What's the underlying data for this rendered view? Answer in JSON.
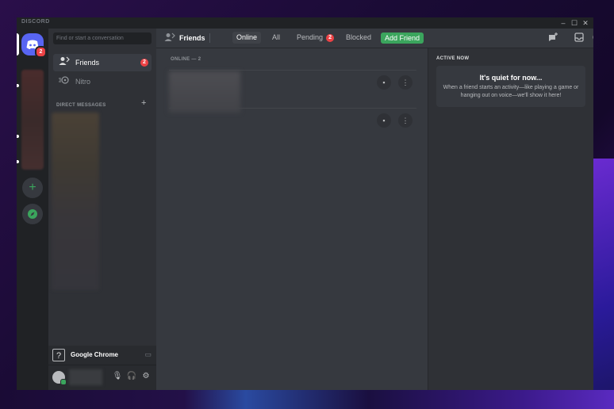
{
  "window": {
    "app_name": "DISCORD",
    "controls": [
      "–",
      "☐",
      "✕"
    ]
  },
  "rail": {
    "home_badge": "2"
  },
  "sidebar": {
    "search_placeholder": "Find or start a conversation",
    "items": [
      {
        "label": "Friends",
        "badge": "2",
        "icon": "friends-icon"
      },
      {
        "label": "Nitro",
        "icon": "nitro-icon"
      }
    ],
    "dm_header": "DIRECT MESSAGES",
    "activity_name": "Google Chrome"
  },
  "topbar": {
    "title": "Friends",
    "tabs": [
      {
        "label": "Online",
        "active": true
      },
      {
        "label": "All"
      },
      {
        "label": "Pending",
        "badge": "2"
      },
      {
        "label": "Blocked"
      }
    ],
    "add_friend": "Add Friend"
  },
  "friends": {
    "online_header": "ONLINE — 2"
  },
  "active_now": {
    "header": "ACTIVE NOW",
    "title": "It's quiet for now...",
    "description": "When a friend starts an activity—like playing a game or hanging out on voice—we'll show it here!"
  },
  "colors": {
    "blurple": "#5865f2",
    "green": "#3ba55d",
    "red": "#ed4245"
  }
}
